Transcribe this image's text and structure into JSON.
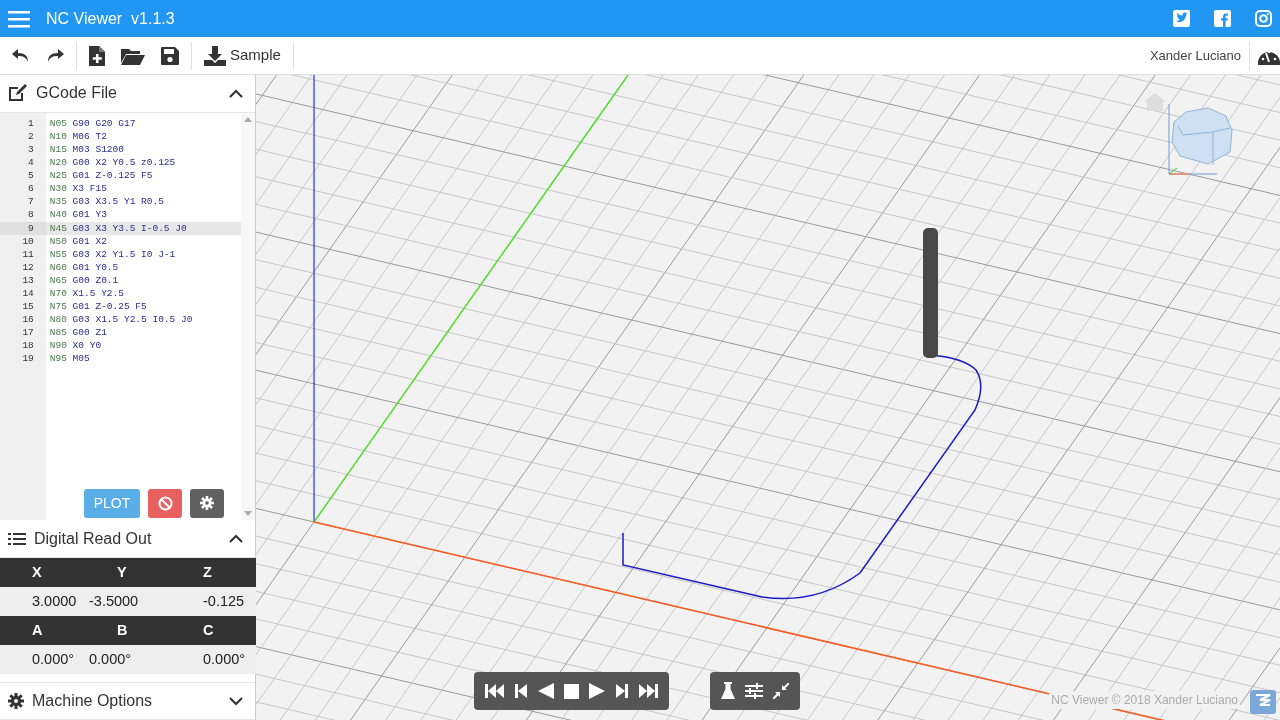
{
  "app": {
    "title": "NC Viewer  v1.1.3"
  },
  "toolbar": {
    "sample_label": "Sample",
    "user": "Xander Luciano"
  },
  "gcode_panel": {
    "title": "GCode File",
    "expanded": true,
    "plot_label": "PLOT",
    "lines": [
      {
        "number": "1",
        "code": "N05 G90 G20 G17",
        "highlighted": false
      },
      {
        "number": "2",
        "code": "N10 M06 T2",
        "highlighted": false
      },
      {
        "number": "3",
        "code": "N15 M03 S1200",
        "highlighted": false
      },
      {
        "number": "4",
        "code": "N20 G00 X2 Y0.5 z0.125",
        "highlighted": false
      },
      {
        "number": "5",
        "code": "N25 G01 Z-0.125 F5",
        "highlighted": false
      },
      {
        "number": "6",
        "code": "N30 X3 F15",
        "highlighted": false
      },
      {
        "number": "7",
        "code": "N35 G03 X3.5 Y1 R0.5",
        "highlighted": false
      },
      {
        "number": "8",
        "code": "N40 G01 Y3",
        "highlighted": false
      },
      {
        "number": "9",
        "code": "N45 G03 X3 Y3.5 I-0.5 J0",
        "highlighted": true
      },
      {
        "number": "10",
        "code": "N50 G01 X2",
        "highlighted": false
      },
      {
        "number": "11",
        "code": "N55 G03 X2 Y1.5 I0 J-1",
        "highlighted": false
      },
      {
        "number": "12",
        "code": "N60 G01 Y0.5",
        "highlighted": false
      },
      {
        "number": "13",
        "code": "N65 G00 Z0.1",
        "highlighted": false
      },
      {
        "number": "14",
        "code": "N70 X1.5 Y2.5",
        "highlighted": false
      },
      {
        "number": "15",
        "code": "N75 G01 Z-0.25 F5",
        "highlighted": false
      },
      {
        "number": "16",
        "code": "N80 G03 X1.5 Y2.5 I0.5 J0",
        "highlighted": false
      },
      {
        "number": "17",
        "code": "N85 G00 Z1",
        "highlighted": false
      },
      {
        "number": "18",
        "code": "N90 X0 Y0",
        "highlighted": false
      },
      {
        "number": "19",
        "code": "N95 M05",
        "highlighted": false
      }
    ]
  },
  "dro": {
    "title": "Digital Read Out",
    "expanded": true,
    "rows": [
      {
        "kind": "header",
        "cells": [
          "X",
          "Y",
          "Z"
        ]
      },
      {
        "kind": "value",
        "cells": [
          "3.0000",
          "-3.5000",
          "-0.125"
        ]
      },
      {
        "kind": "header",
        "cells": [
          "A",
          "B",
          "C"
        ]
      },
      {
        "kind": "value",
        "cells": [
          "0.000°",
          "0.000°",
          "0.000°"
        ]
      }
    ]
  },
  "machine_options": {
    "title": "Machine Options",
    "expanded": false
  },
  "viewer": {
    "footer": "NC Viewer © 2018 Xander Luciano"
  }
}
